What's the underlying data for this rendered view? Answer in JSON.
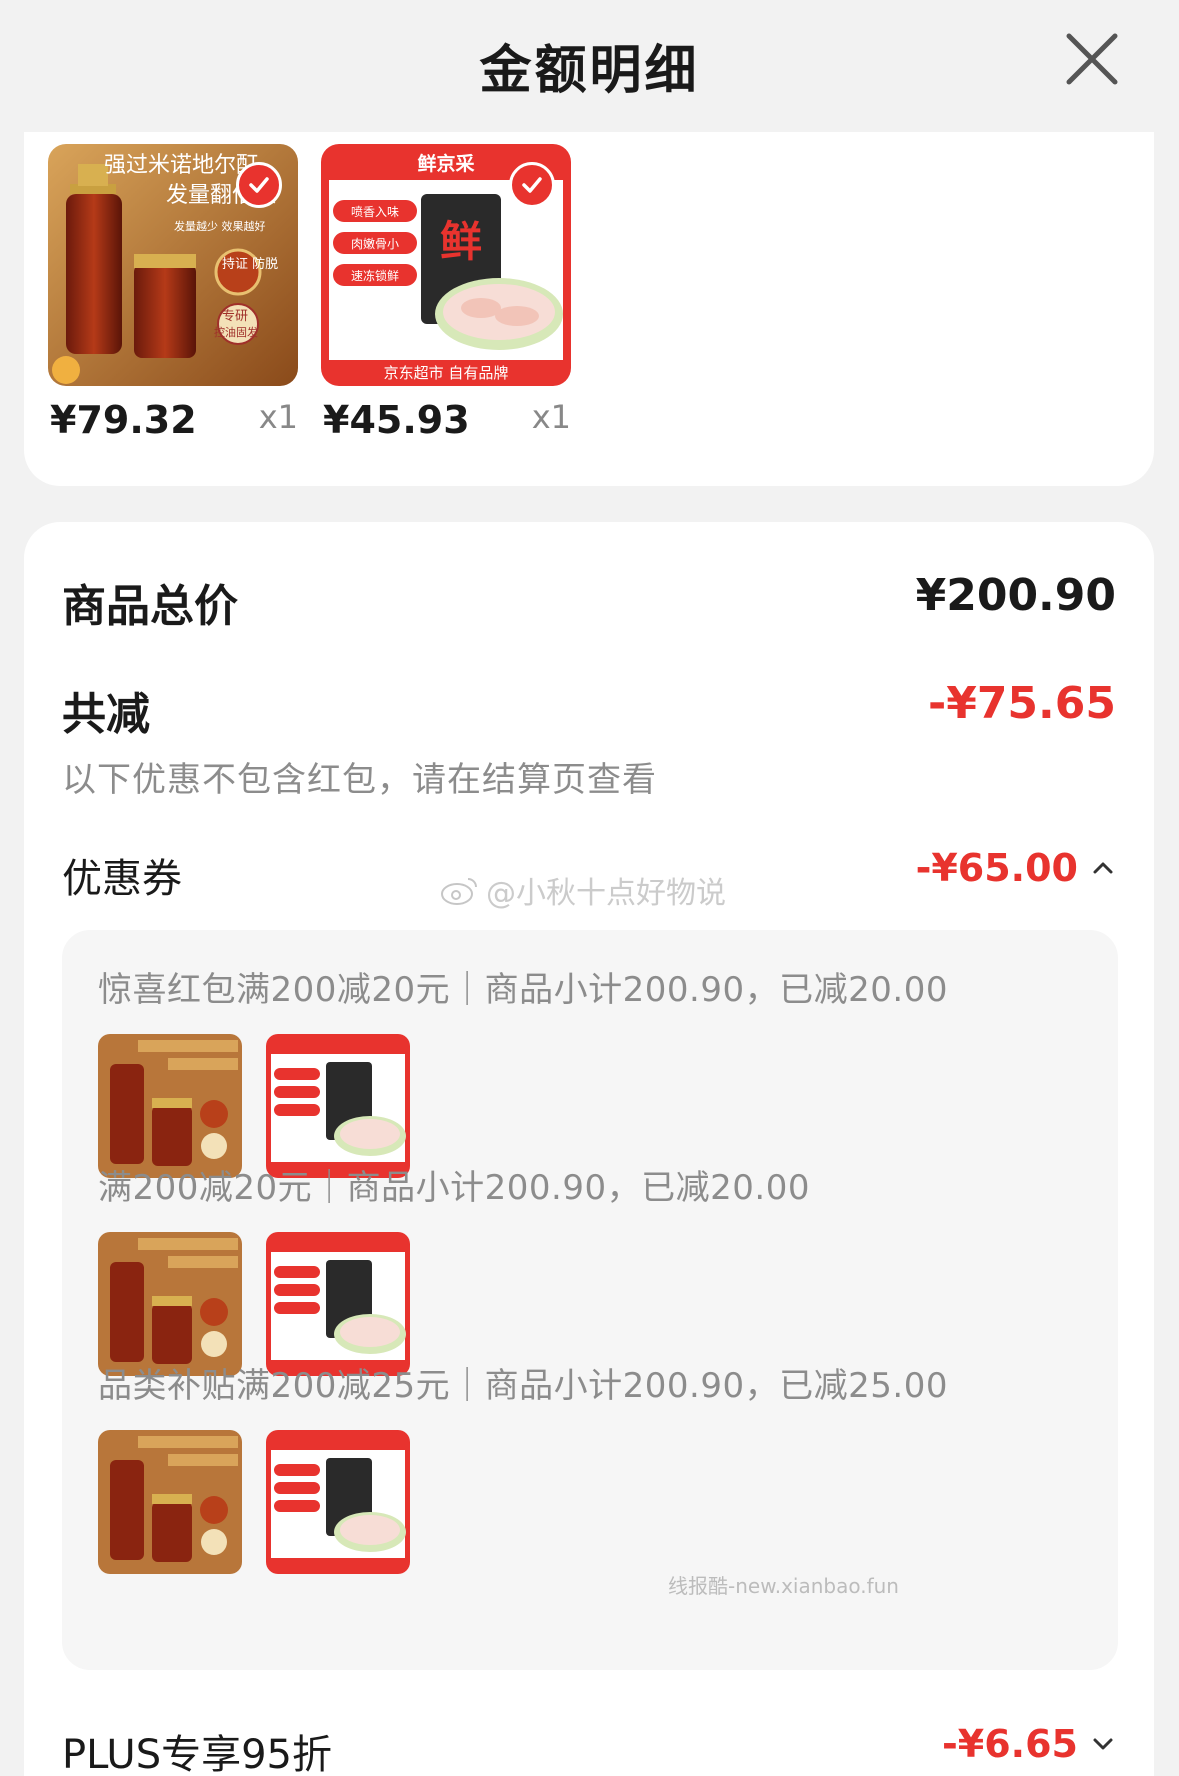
{
  "header": {
    "title": "金额明细"
  },
  "products": [
    {
      "price": "¥79.32",
      "qty": "x1",
      "image": {
        "line1": "强过米诺地尔酊",
        "line2": "发量翻倍涨",
        "tag1": "发量越少 效果越好",
        "badge1": "持证 防脱",
        "badge2": "专研",
        "badge3": "控油固发"
      }
    },
    {
      "price": "¥45.93",
      "qty": "x1",
      "image": {
        "brand": "鲜京采",
        "tag1": "喷香入味",
        "tag2": "肉嫩骨小",
        "tag3": "速冻锁鲜",
        "char": "鲜",
        "footer": "京东超市 自有品牌"
      }
    }
  ],
  "summary": {
    "total_label": "商品总价",
    "total_value": "¥200.90",
    "discount_label": "共减",
    "discount_value": "-¥75.65",
    "note": "以下优惠不包含红包，请在结算页查看"
  },
  "coupon": {
    "label": "优惠券",
    "value": "-¥65.00",
    "lines": [
      "惊喜红包满200减20元｜商品小计200.90，已减20.00",
      "满200减20元｜商品小计200.90，已减20.00",
      "品类补贴满200减25元｜商品小计200.90，已减25.00"
    ]
  },
  "plus": {
    "label": "PLUS专享95折",
    "value": "-¥6.65"
  },
  "watermarks": {
    "weibo": "@小秋十点好物说",
    "site": "线报酷-new.xianbao.fun"
  },
  "colors": {
    "accent": "#e8332e",
    "text": "#1a1a1a",
    "muted": "#8c8c8c"
  }
}
